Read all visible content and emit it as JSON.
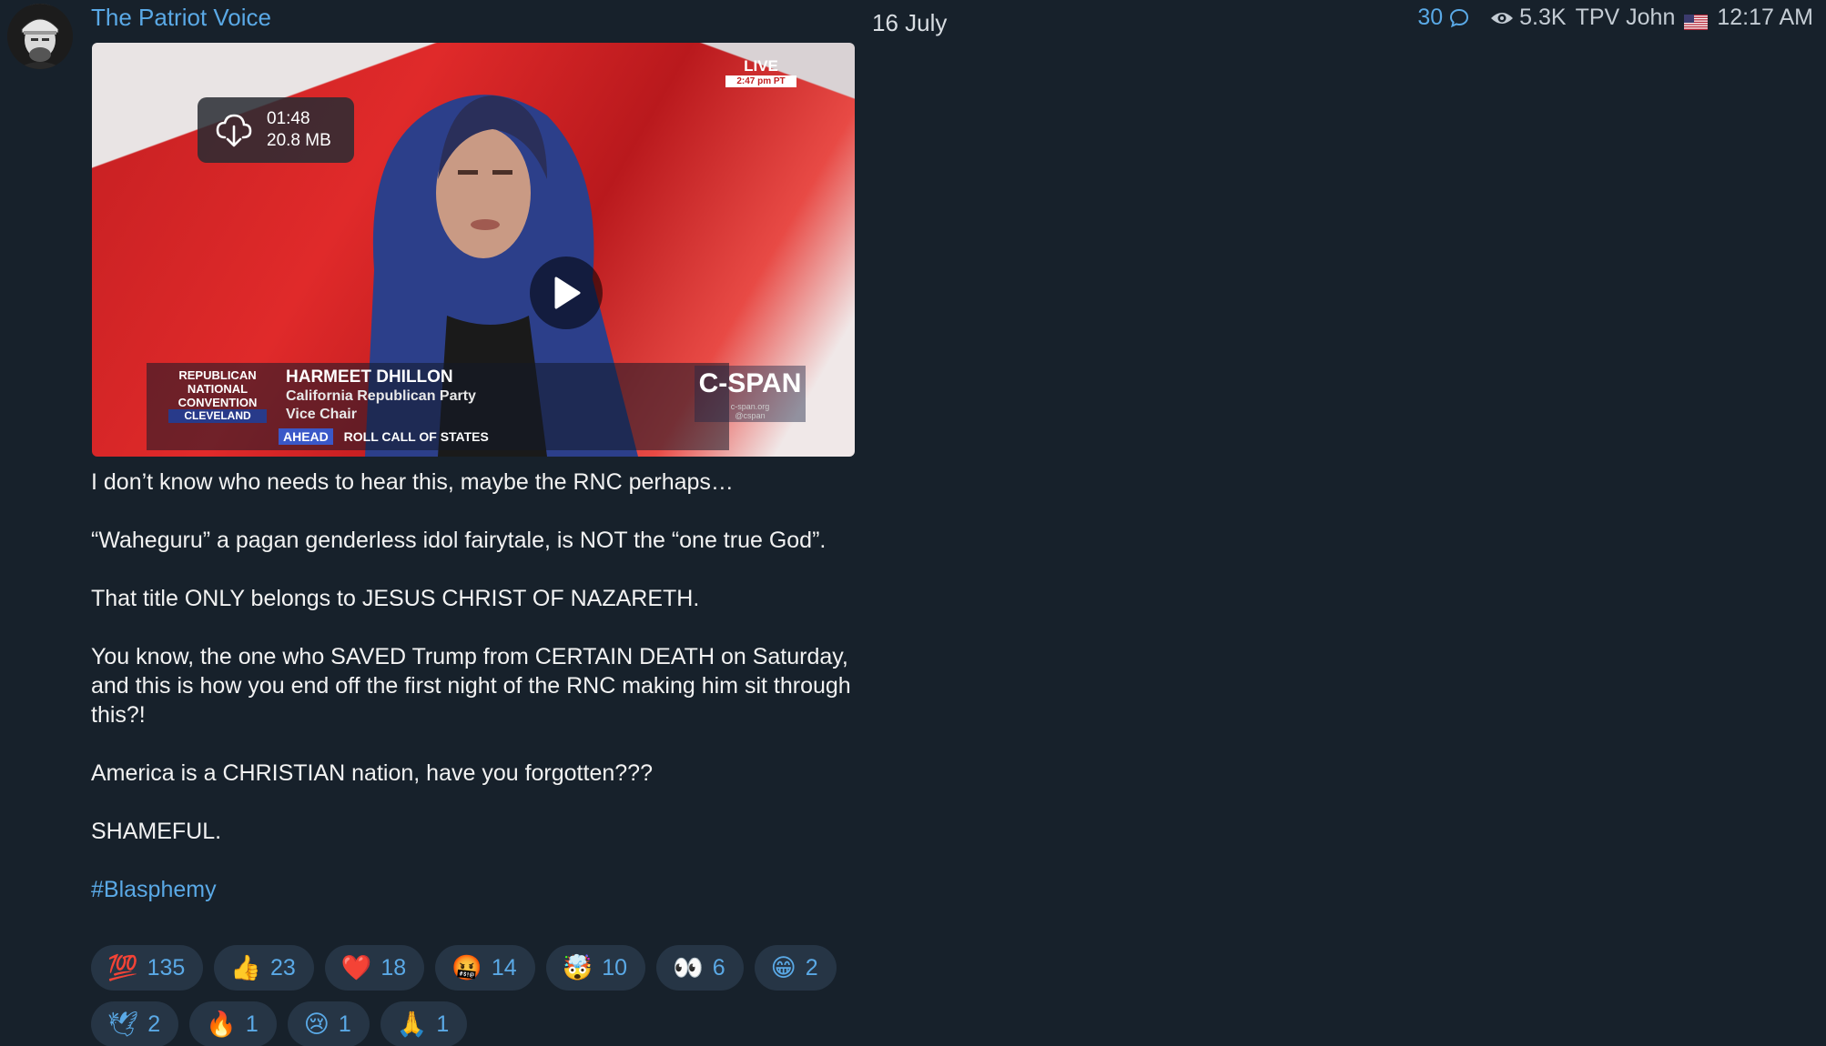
{
  "channel": {
    "name": "The Patriot Voice"
  },
  "date_chip": "16 July",
  "meta": {
    "comments": "30",
    "views": "5.3K",
    "author": "TPV John",
    "time": "12:17 AM",
    "accent": "#5aa9e6"
  },
  "video": {
    "duration": "01:48",
    "size": "20.8 MB",
    "live_label": "LIVE",
    "live_time": "2:47 pm PT",
    "rnc_lines": [
      "REPUBLICAN",
      "NATIONAL",
      "CONVENTION"
    ],
    "rnc_city": "CLEVELAND",
    "speaker_name": "HARMEET DHILLON",
    "speaker_title": "California Republican Party",
    "speaker_role": "Vice Chair",
    "ahead_tag": "AHEAD",
    "ahead_text": "ROLL CALL OF STATES",
    "network": "C-SPAN",
    "network_url": "c-span.org",
    "network_handle": "@cspan"
  },
  "post": {
    "paragraphs": [
      "I don’t know who needs to hear this, maybe the RNC perhaps…",
      "“Waheguru” a pagan genderless idol fairytale, is NOT the “one true God”.",
      "That title ONLY belongs to JESUS CHRIST OF NAZARETH.",
      "You know, the one who SAVED Trump from CERTAIN DEATH on Saturday, and this is how you end off the first night of the RNC making him sit through this?!",
      "America is a CHRISTIAN nation, have you forgotten???",
      "SHAMEFUL."
    ],
    "hashtag": "#Blasphemy"
  },
  "reactions": [
    {
      "emoji": "💯",
      "count": "135"
    },
    {
      "emoji": "👍",
      "count": "23"
    },
    {
      "emoji": "❤️",
      "count": "18"
    },
    {
      "emoji": "🤬",
      "count": "14"
    },
    {
      "emoji": "🤯",
      "count": "10"
    },
    {
      "emoji": "👀",
      "count": "6"
    },
    {
      "emoji": "😁",
      "count": "2"
    },
    {
      "emoji": "🕊",
      "count": "2"
    },
    {
      "emoji": "🔥",
      "count": "1"
    },
    {
      "emoji": "😢",
      "count": "1"
    },
    {
      "emoji": "🙏",
      "count": "1"
    }
  ]
}
